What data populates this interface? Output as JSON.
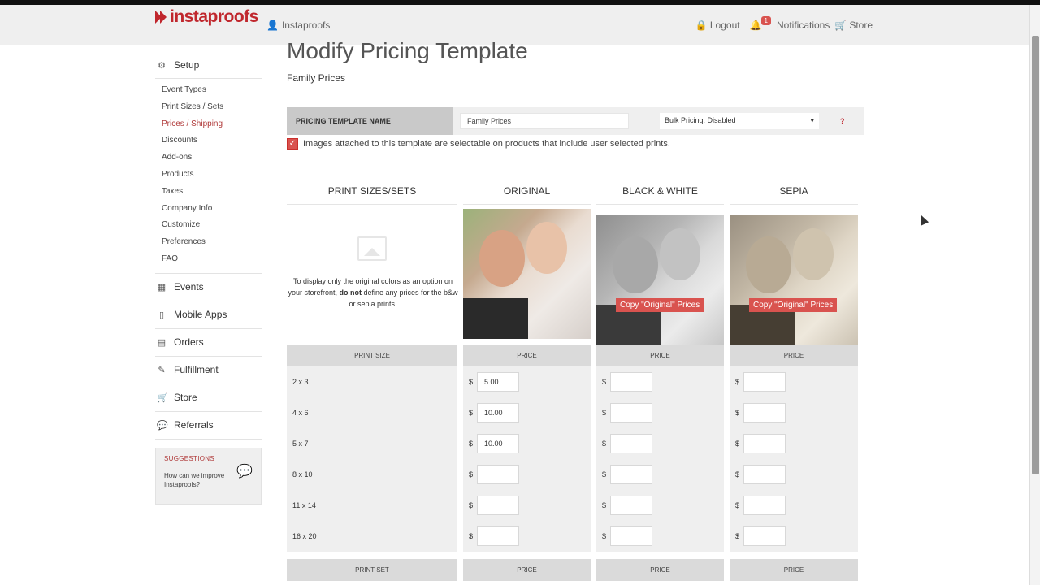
{
  "header": {
    "logo_a": "insta",
    "logo_b": "proofs",
    "account_label": "Instaproofs",
    "logout_label": "Logout",
    "notifications_count": "1",
    "notifications_label": "Notifications",
    "store_label": "Store"
  },
  "sidebar": {
    "setup_label": "Setup",
    "setup_items": [
      {
        "label": "Event Types"
      },
      {
        "label": "Print Sizes / Sets"
      },
      {
        "label": "Prices / Shipping"
      },
      {
        "label": "Discounts"
      },
      {
        "label": "Add-ons"
      },
      {
        "label": "Products"
      },
      {
        "label": "Taxes"
      },
      {
        "label": "Company Info"
      },
      {
        "label": "Customize"
      },
      {
        "label": "Preferences"
      },
      {
        "label": "FAQ"
      }
    ],
    "main_items": [
      {
        "label": "Events"
      },
      {
        "label": "Mobile Apps"
      },
      {
        "label": "Orders"
      },
      {
        "label": "Fulfillment"
      },
      {
        "label": "Store"
      },
      {
        "label": "Referrals"
      }
    ],
    "suggestions": {
      "heading": "SUGGESTIONS",
      "text": "How can we improve Instaproofs?"
    }
  },
  "page": {
    "title": "Modify Pricing Template",
    "subtitle": "Family Prices"
  },
  "template": {
    "name_label": "PRICING TEMPLATE NAME",
    "name_value": "Family Prices",
    "bulk_pricing": "Bulk Pricing: Disabled",
    "help": "?",
    "checkbox_label": "Images attached to this template are selectable on products that include user selected prints."
  },
  "grid": {
    "headers": [
      "PRINT SIZES/SETS",
      "ORIGINAL",
      "BLACK & WHITE",
      "SEPIA"
    ],
    "info_before": "To display only the original colors as an option on your storefront, ",
    "info_bold": "do not",
    "info_after": " define any prices for the b&w or sepia prints.",
    "copy_label": "Copy \"Original\" Prices",
    "size_head": "PRINT SIZE",
    "price_head": "PRICE",
    "set_head": "PRINT SET",
    "currency": "$",
    "rows": [
      {
        "size": "2 x 3",
        "original": "5.00"
      },
      {
        "size": "4 x 6",
        "original": "10.00"
      },
      {
        "size": "5 x 7",
        "original": "10.00"
      },
      {
        "size": "8 x 10",
        "original": ""
      },
      {
        "size": "11 x 14",
        "original": ""
      },
      {
        "size": "16 x 20",
        "original": ""
      }
    ]
  }
}
